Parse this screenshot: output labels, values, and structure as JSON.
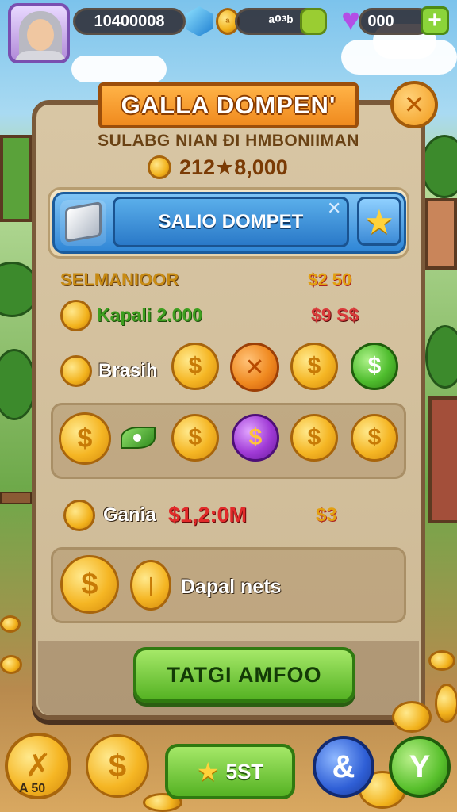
{
  "topbar": {
    "gold_total": "10400008",
    "coins": "ᵃ⁰³ᵇ",
    "hearts": "000"
  },
  "panel": {
    "title": "GALLA DOMPEN'",
    "subtitle": "SULABG NIAN ÐI HMBONIIMAN",
    "total": "212★8,000",
    "wallet_input": "SALIO DOMPET",
    "rows": [
      {
        "label": "SELMANIOOR",
        "value": "$2 50"
      },
      {
        "label": "Kapali 2.000",
        "value": "$9 S$"
      },
      {
        "label": "Brasih"
      },
      {
        "label": "Gania",
        "value": "$1,2:0M",
        "value2": "$3"
      },
      {
        "label": "Dapal nets"
      }
    ],
    "cta": "TATGI AMFOO"
  },
  "bottom": {
    "star_button": "5ST",
    "corner_label": "A 50"
  },
  "colors": {
    "orange_banner": "#f08a1e",
    "blue_bar": "#2f86d6",
    "green_button": "#55b223",
    "gold": "#f2b21c"
  },
  "icons": [
    "gem-icon",
    "coin-icon",
    "smiley-icon",
    "heart-icon",
    "plus-icon",
    "close-icon",
    "cube-icon",
    "star-icon",
    "leaf-icon",
    "dollar-icon",
    "swirl-icon",
    "y-icon"
  ]
}
